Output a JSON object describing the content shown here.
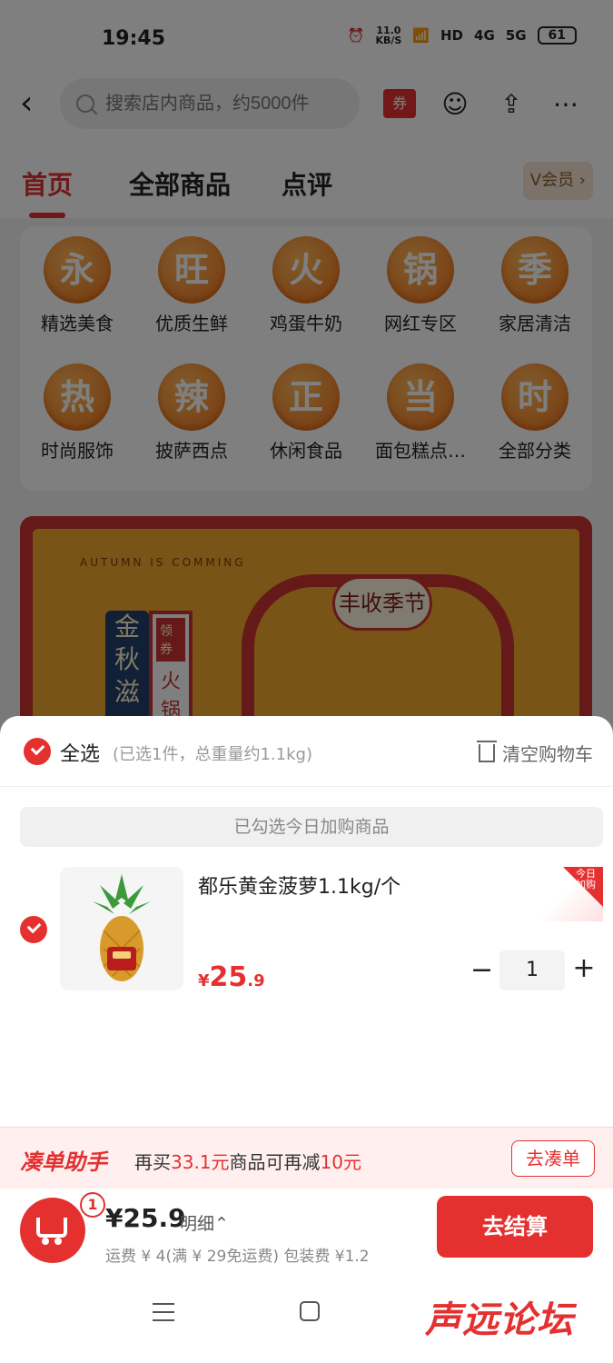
{
  "status_bar": {
    "time": "19:45",
    "net_speed": "11.0",
    "net_unit": "KB/S",
    "hd": "HD",
    "net_4g": "4G",
    "net_5g": "5G",
    "battery": "61"
  },
  "topnav": {
    "search_placeholder": "搜索店内商品，约5000件",
    "coupon_label": "券"
  },
  "tabs": {
    "home": "首页",
    "all": "全部商品",
    "review": "点评",
    "vip": "V会员 ›"
  },
  "categories": [
    {
      "char": "永",
      "label": "精选美食"
    },
    {
      "char": "旺",
      "label": "优质生鲜"
    },
    {
      "char": "火",
      "label": "鸡蛋牛奶"
    },
    {
      "char": "锅",
      "label": "网红专区"
    },
    {
      "char": "季",
      "label": "家居清洁"
    },
    {
      "char": "热",
      "label": "时尚服饰"
    },
    {
      "char": "辣",
      "label": "披萨西点"
    },
    {
      "char": "正",
      "label": "休闲食品"
    },
    {
      "char": "当",
      "label": "面包糕点…"
    },
    {
      "char": "时",
      "label": "全部分类"
    }
  ],
  "banner": {
    "autumn": "AUTUMN IS COMMING",
    "season": "丰收季节",
    "gold": "金秋滋",
    "coupon": "领券",
    "fire": "火锅"
  },
  "cart_sheet": {
    "select_all": "全选",
    "select_summary": "(已选1件，总重量约1.1kg)",
    "clear": "清空购物车",
    "today_strip": "已勾选今日加购商品",
    "item": {
      "name": "都乐黄金菠萝1.1kg/个",
      "currency": "¥",
      "price_int": "25",
      "price_dec": ".9",
      "tag": "今日加购",
      "qty": "1",
      "minus": "−",
      "plus": "+"
    }
  },
  "helper": {
    "title": "凑单助手",
    "text_prefix": "再买",
    "need_amount": "33.1元",
    "text_mid": "商品可再减",
    "discount": "10元",
    "button": "去凑单"
  },
  "checkout": {
    "badge": "1",
    "total": "¥25.9",
    "detail": "明细⌃",
    "fees": "运费 ¥ 4(满 ¥ 29免运费)   包装费 ¥1.2",
    "button": "去结算"
  },
  "watermark": "声远论坛",
  "colors": {
    "accent": "#e53030"
  }
}
